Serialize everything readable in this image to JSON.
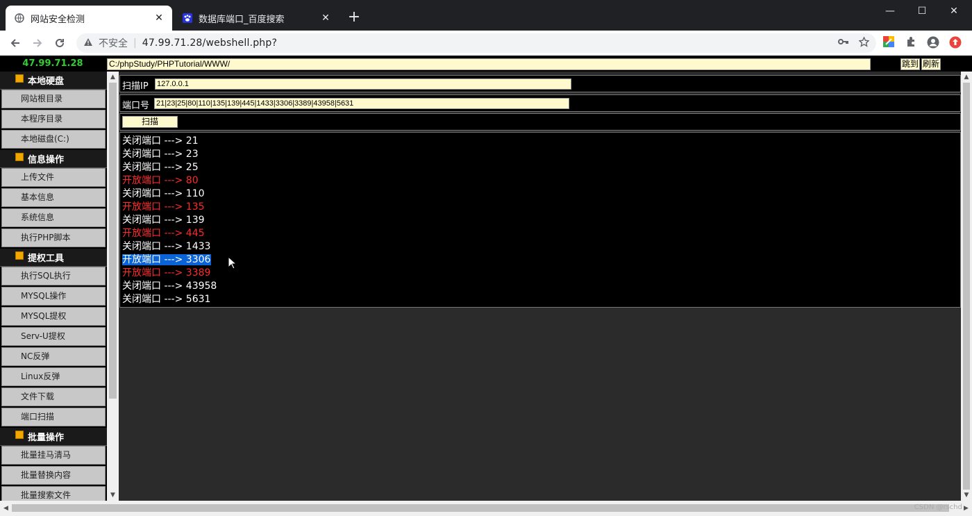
{
  "browser": {
    "tabs": [
      {
        "title": "网站安全检测",
        "active": true
      },
      {
        "title": "数据库端口_百度搜索",
        "active": false
      }
    ],
    "new_tab": "+",
    "close_glyph": "✕",
    "window_controls": {
      "minimize": "—",
      "maximize": "☐",
      "close": "✕"
    },
    "address": {
      "insecure_label": "不安全",
      "separator": "|",
      "url": "47.99.71.28/webshell.php?"
    }
  },
  "page": {
    "server_ip": "47.99.71.28",
    "path_value": "C:/phpStudy/PHPTutorial/WWW/",
    "jump_label": "跳到",
    "refresh_label": "刷新"
  },
  "sidebar": {
    "sections": [
      {
        "title": "本地硬盘",
        "items": [
          "网站根目录",
          "本程序目录",
          "本地磁盘(C:)"
        ]
      },
      {
        "title": "信息操作",
        "items": [
          "上传文件",
          "基本信息",
          "系统信息",
          "执行PHP脚本"
        ]
      },
      {
        "title": "提权工具",
        "items": [
          "执行SQL执行",
          "MYSQL操作",
          "MYSQL提权",
          "Serv-U提权",
          "NC反弹",
          "Linux反弹",
          "文件下载",
          "端口扫描"
        ]
      },
      {
        "title": "批量操作",
        "items": [
          "批量挂马清马",
          "批量替换内容",
          "批量搜索文件"
        ]
      }
    ]
  },
  "scan": {
    "ip_label": "扫描IP",
    "ip_value": "127.0.0.1",
    "ports_label": "端口号",
    "ports_value": "21|23|25|80|110|135|139|445|1433|3306|3389|43958|5631",
    "scan_button": "扫描"
  },
  "results": [
    {
      "text": "关闭端口 ---> 21",
      "status": "closed"
    },
    {
      "text": "关闭端口 ---> 23",
      "status": "closed"
    },
    {
      "text": "关闭端口 ---> 25",
      "status": "closed"
    },
    {
      "text": "开放端口 ---> 80",
      "status": "open"
    },
    {
      "text": "关闭端口 ---> 110",
      "status": "closed"
    },
    {
      "text": "开放端口 ---> 135",
      "status": "open"
    },
    {
      "text": "关闭端口 ---> 139",
      "status": "closed"
    },
    {
      "text": "开放端口 ---> 445",
      "status": "open"
    },
    {
      "text": "关闭端口 ---> 1433",
      "status": "closed"
    },
    {
      "text": "开放端口 ---> 3306",
      "status": "open",
      "selected": true
    },
    {
      "text": "开放端口 ---> 3389",
      "status": "open"
    },
    {
      "text": "关闭端口 ---> 43958",
      "status": "closed"
    },
    {
      "text": "关闭端口 ---> 5631",
      "status": "closed"
    }
  ],
  "watermark": "CSDN @rschd",
  "colors": {
    "open": "#ff2a2a",
    "closed": "#ffffff",
    "selection": "#0a64d8",
    "server_ip": "#33cc33",
    "input_bg": "#fffacd"
  }
}
